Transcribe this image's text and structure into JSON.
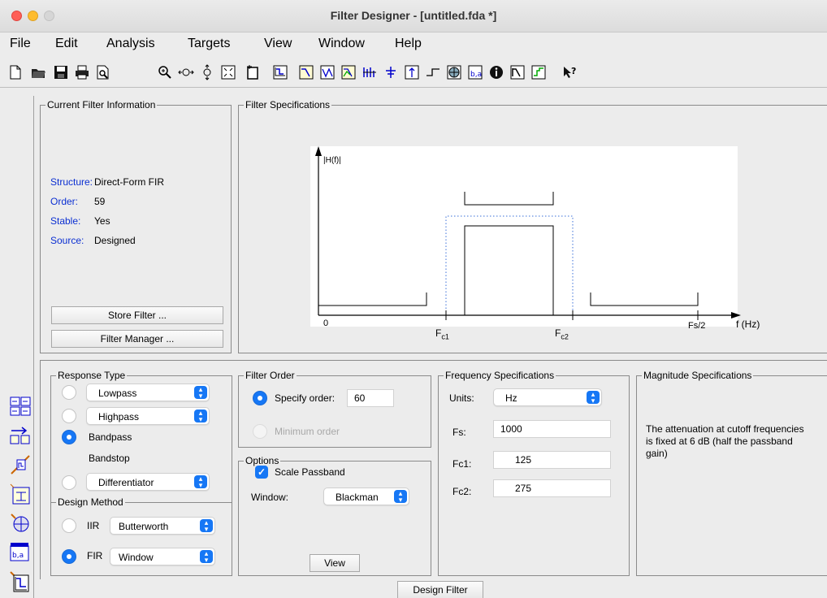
{
  "window": {
    "title": "Filter Designer -  [untitled.fda *]"
  },
  "menu": [
    "File",
    "Edit",
    "Analysis",
    "Targets",
    "View",
    "Window",
    "Help"
  ],
  "current_filter": {
    "title": "Current Filter Information",
    "rows": [
      {
        "label": "Structure:",
        "value": "Direct-Form FIR"
      },
      {
        "label": "Order:",
        "value": "59"
      },
      {
        "label": "Stable:",
        "value": "Yes"
      },
      {
        "label": "Source:",
        "value": "Designed"
      }
    ],
    "store_button": "Store Filter ...",
    "manager_button": "Filter Manager ..."
  },
  "filter_specs": {
    "title": "Filter Specifications",
    "ylabel": "|H(f)|",
    "x0": "0",
    "fc1_main": "F",
    "fc1_sub": "c1",
    "fc2_main": "F",
    "fc2_sub": "c2",
    "fs2": "Fs/2",
    "xlabel": "f (Hz)"
  },
  "response_type": {
    "title": "Response Type",
    "lowpass": "Lowpass",
    "highpass": "Highpass",
    "bandpass": "Bandpass",
    "bandstop": "Bandstop",
    "differentiator": "Differentiator",
    "selected": "Bandpass"
  },
  "design_method": {
    "title": "Design Method",
    "iir_label": "IIR",
    "iir_value": "Butterworth",
    "fir_label": "FIR",
    "fir_value": "Window",
    "selected": "FIR"
  },
  "filter_order": {
    "title": "Filter Order",
    "specify_label": "Specify order:",
    "specify_value": "60",
    "minimum_label": "Minimum order"
  },
  "options": {
    "title": "Options",
    "scale_passband": "Scale Passband",
    "scale_passband_checked": true,
    "window_label": "Window:",
    "window_value": "Blackman",
    "view_button": "View"
  },
  "frequency_specs": {
    "title": "Frequency Specifications",
    "units_label": "Units:",
    "units_value": "Hz",
    "fs_label": "Fs:",
    "fs_value": "1000",
    "fc1_label": "Fc1:",
    "fc1_value": "125",
    "fc2_label": "Fc2:",
    "fc2_value": "275"
  },
  "magnitude_specs": {
    "title": "Magnitude Specifications",
    "text": "The attenuation at cutoff frequencies is fixed at 6 dB (half the passband gain)"
  },
  "design_button": "Design Filter",
  "colors": {
    "accent": "#1677f5",
    "label_blue": "#0b2fd2",
    "background": "#ececec"
  }
}
